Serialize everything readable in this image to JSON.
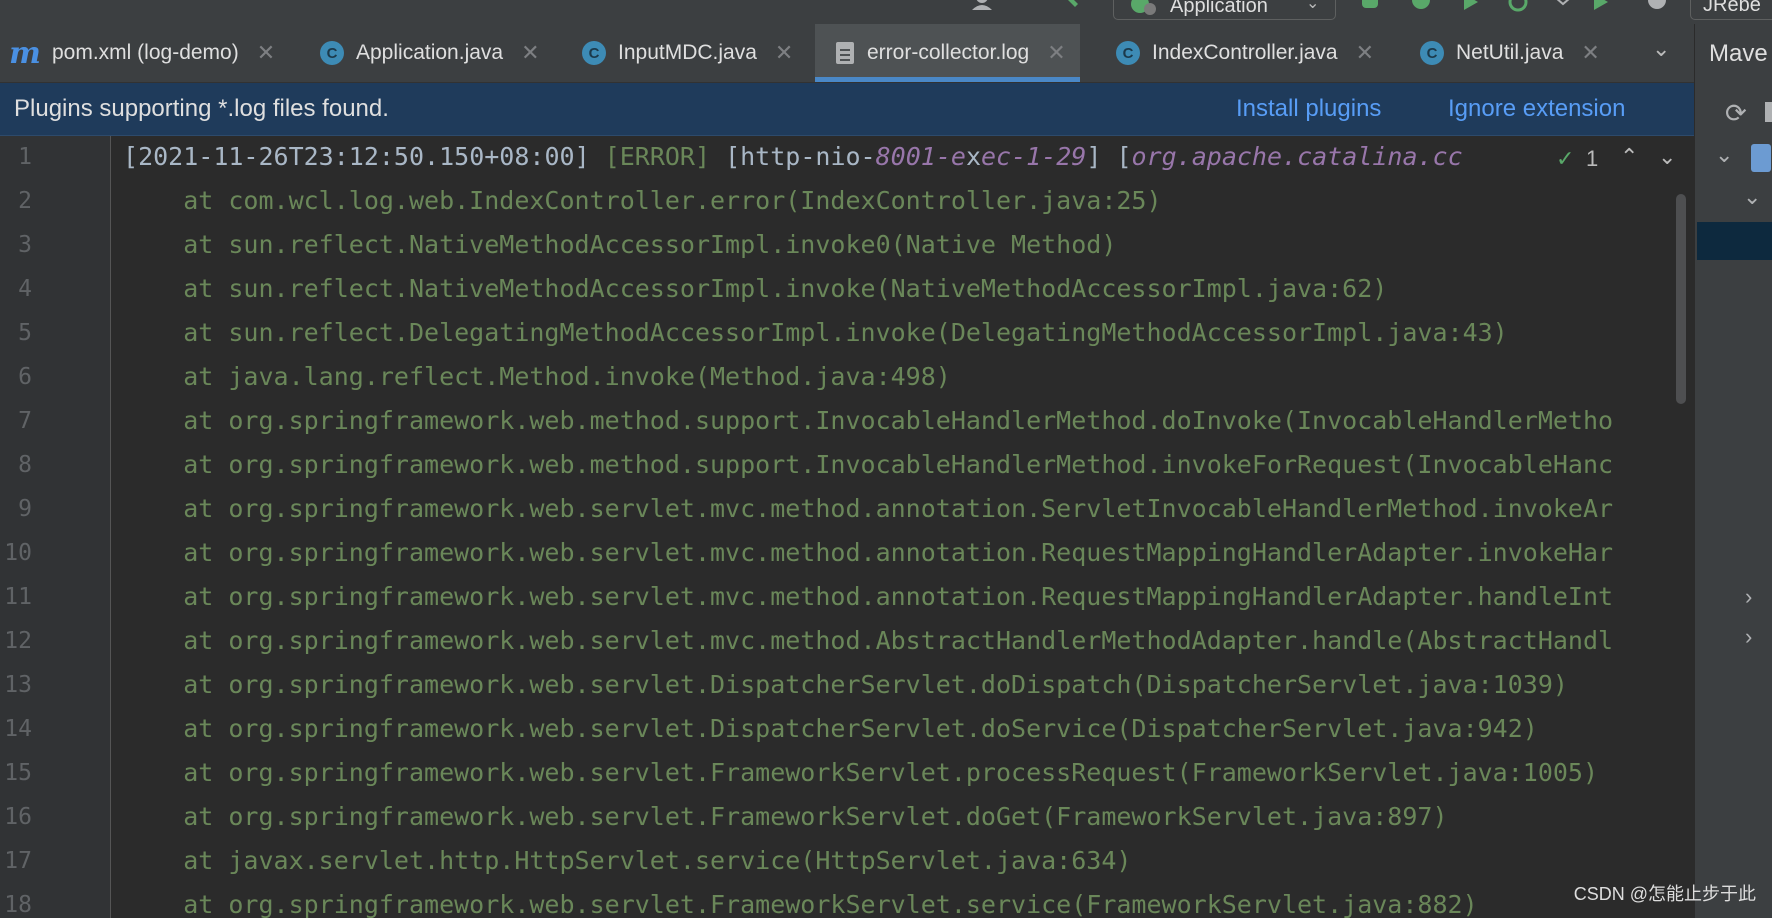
{
  "toolbar": {
    "run_config": "Application",
    "plugin": "JRebe",
    "accent": "#59a869"
  },
  "tabs": [
    {
      "label": "pom.xml (log-demo)",
      "icon": "maven-icon",
      "active": false
    },
    {
      "label": "Application.java",
      "icon": "spring-class-icon",
      "active": false
    },
    {
      "label": "InputMDC.java",
      "icon": "class-icon",
      "active": false
    },
    {
      "label": "error-collector.log",
      "icon": "log-file-icon",
      "active": true
    },
    {
      "label": "IndexController.java",
      "icon": "class-icon",
      "active": false
    },
    {
      "label": "NetUtil.java",
      "icon": "class-icon",
      "active": false
    }
  ],
  "side_panel": {
    "title": "Mave"
  },
  "banner": {
    "message": "Plugins supporting *.log files found.",
    "install": "Install plugins",
    "ignore": "Ignore extension"
  },
  "inspection": {
    "count": "1"
  },
  "log_first": {
    "bracket_open": "[",
    "timestamp": "2021-11-26T23:12:50.150+08:00",
    "bracket_close": "] ",
    "level": "[ERROR]",
    "thread_open": " [http-nio-",
    "thread_num": "8001",
    "thread_dash": "-e",
    "thread_x": "x",
    "thread_rest": "ec-1-29",
    "thread_close": "] [",
    "logger": "org.apache.catalina.cc"
  },
  "log_lines": [
    "1",
    "    at com.wcl.log.web.IndexController.error(IndexController.java:25)",
    "    at sun.reflect.NativeMethodAccessorImpl.invoke0(Native Method)",
    "    at sun.reflect.NativeMethodAccessorImpl.invoke(NativeMethodAccessorImpl.java:62)",
    "    at sun.reflect.DelegatingMethodAccessorImpl.invoke(DelegatingMethodAccessorImpl.java:43)",
    "    at java.lang.reflect.Method.invoke(Method.java:498)",
    "    at org.springframework.web.method.support.InvocableHandlerMethod.doInvoke(InvocableHandlerMetho",
    "    at org.springframework.web.method.support.InvocableHandlerMethod.invokeForRequest(InvocableHanc",
    "    at org.springframework.web.servlet.mvc.method.annotation.ServletInvocableHandlerMethod.invokeAr",
    "    at org.springframework.web.servlet.mvc.method.annotation.RequestMappingHandlerAdapter.invokeHar",
    "    at org.springframework.web.servlet.mvc.method.annotation.RequestMappingHandlerAdapter.handleInt",
    "    at org.springframework.web.servlet.mvc.method.AbstractHandlerMethodAdapter.handle(AbstractHandl",
    "    at org.springframework.web.servlet.DispatcherServlet.doDispatch(DispatcherServlet.java:1039)",
    "    at org.springframework.web.servlet.DispatcherServlet.doService(DispatcherServlet.java:942)",
    "    at org.springframework.web.servlet.FrameworkServlet.processRequest(FrameworkServlet.java:1005)",
    "    at org.springframework.web.servlet.FrameworkServlet.doGet(FrameworkServlet.java:897)",
    "    at javax.servlet.http.HttpServlet.service(HttpServlet.java:634)",
    "    at org.springframework.web.servlet.FrameworkServlet.service(FrameworkServlet.java:882)"
  ],
  "line_numbers": [
    "1",
    "2",
    "3",
    "4",
    "5",
    "6",
    "7",
    "8",
    "9",
    "10",
    "11",
    "12",
    "13",
    "14",
    "15",
    "16",
    "17",
    "18"
  ],
  "watermark": "CSDN @怎能止步于此"
}
